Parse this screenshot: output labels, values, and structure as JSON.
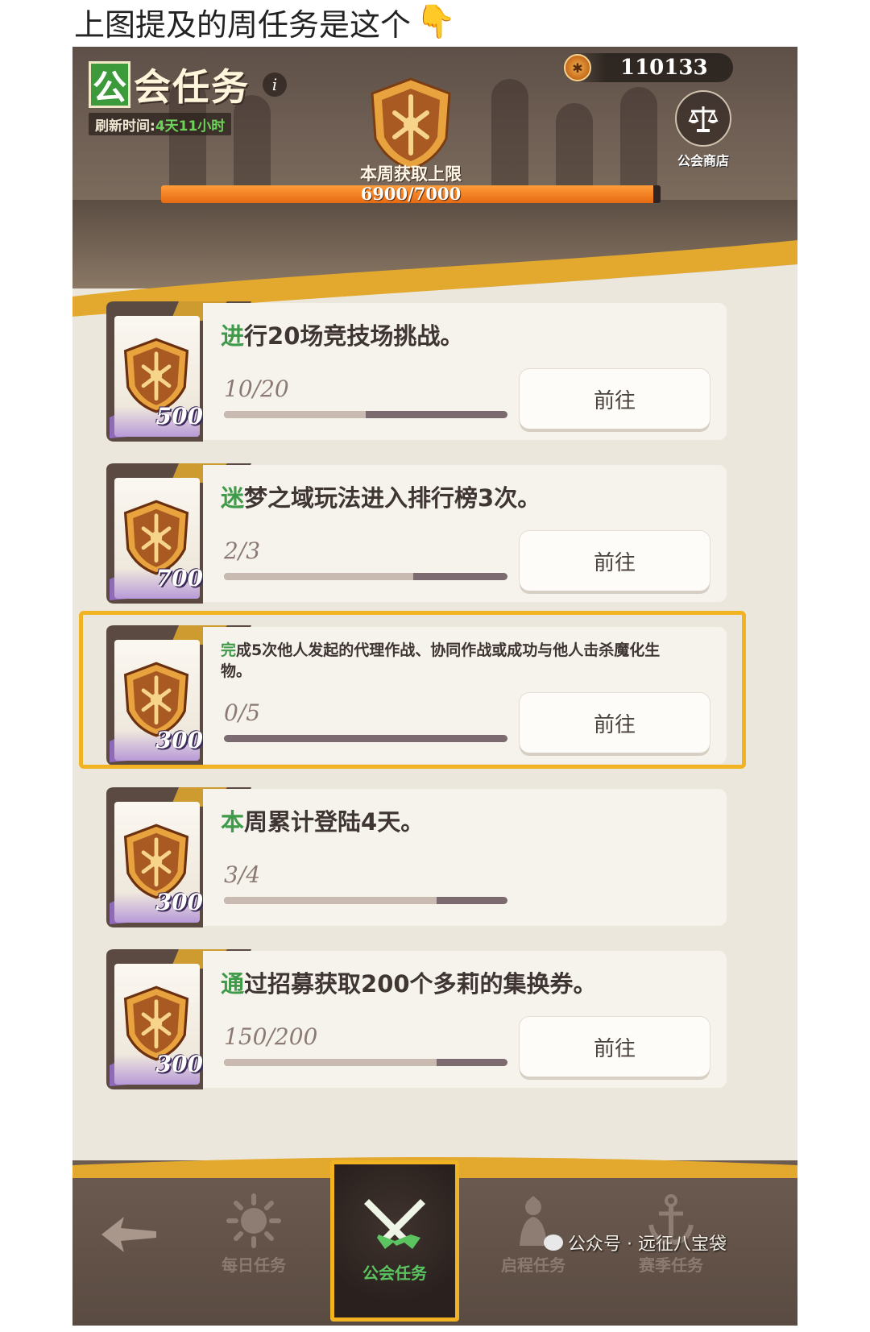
{
  "caption": {
    "text": "上图提及的周任务是这个",
    "emoji": "👇"
  },
  "header": {
    "title_tag": "公",
    "title": "会任务",
    "info_icon": "i",
    "refresh_label": "刷新时间:",
    "refresh_value": "4天11小时",
    "currency_value": "110133",
    "shop_label": "公会商店",
    "weekly_limit_label": "本周获取上限",
    "weekly_progress_text": "6900/7000",
    "weekly_progress": 0.9857
  },
  "tasks": [
    {
      "lead": "进",
      "rest": "行20场竞技场挑战。",
      "reward": "500",
      "progress_text": "10/20",
      "progress": 0.5,
      "button": "前往"
    },
    {
      "lead": "迷",
      "rest": "梦之域玩法进入排行榜3次。",
      "reward": "700",
      "progress_text": "2/3",
      "progress": 0.6667,
      "button": "前往"
    },
    {
      "lead": "完",
      "rest": "成5次他人发起的代理作战、协同作战或成功与他人击杀魔化生物。",
      "reward": "300",
      "progress_text": "0/5",
      "progress": 0,
      "button": "前往"
    },
    {
      "lead": "本",
      "rest": "周累计登陆4天。",
      "reward": "300",
      "progress_text": "3/4",
      "progress": 0.75
    },
    {
      "lead": "通",
      "rest": "过招募获取200个多莉的集换券。",
      "reward": "300",
      "progress_text": "150/200",
      "progress": 0.75,
      "button": "前往"
    }
  ],
  "nav": {
    "daily": "每日任务",
    "guild": "公会任务",
    "journey": "启程任务",
    "season": "赛季任务"
  },
  "watermark": "公众号 · 远征八宝袋",
  "colors": {
    "accent_green": "#3f9a4a",
    "highlight": "#f2b322",
    "progress_orange": "#e66a12"
  }
}
